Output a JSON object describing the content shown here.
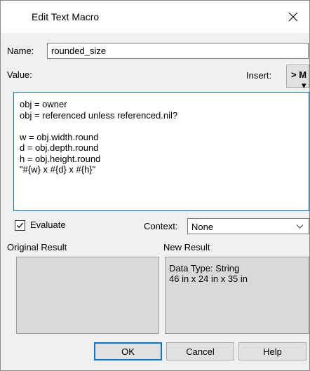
{
  "window": {
    "title": "Edit Text Macro"
  },
  "name_field": {
    "label": "Name:",
    "value": "rounded_size"
  },
  "value_label": "Value:",
  "insert": {
    "label": "Insert:",
    "button_text": "> M",
    "caret": "▾"
  },
  "value_lines": [
    "obj = owner",
    "obj = referenced unless referenced.nil?",
    "",
    "w = obj.width.round",
    "d = obj.depth.round",
    "h = obj.height.round",
    "\"#{w} x #{d} x #{h}\""
  ],
  "evaluate": {
    "label": "Evaluate",
    "checked": true
  },
  "context": {
    "label": "Context:",
    "selected": "None"
  },
  "original_result": {
    "label": "Original Result"
  },
  "new_result": {
    "label": "New Result",
    "lines": [
      "Data Type: String",
      "46 in x 24 in x 35 in"
    ]
  },
  "buttons": {
    "ok": "OK",
    "cancel": "Cancel",
    "help": "Help"
  },
  "colors": {
    "focus": "#0078d7",
    "result_bg": "#d9d9d9",
    "dialog_bg": "#f0f0f0"
  }
}
